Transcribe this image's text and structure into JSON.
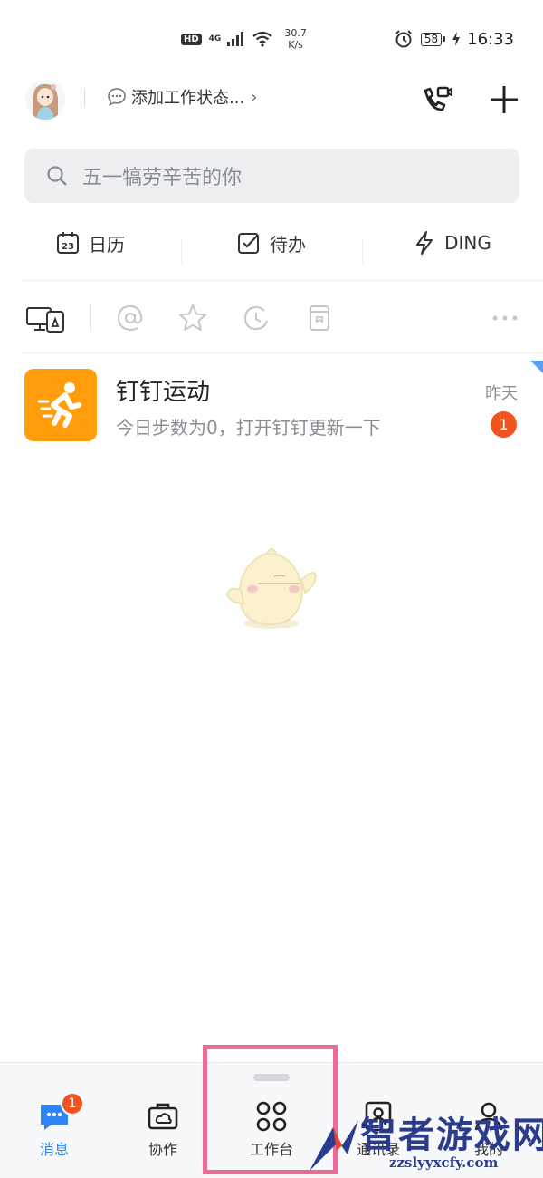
{
  "status_bar": {
    "hd": "HD",
    "network": "4G",
    "speed_value": "30.7",
    "speed_unit": "K/s",
    "battery": "58",
    "time": "16:33"
  },
  "header": {
    "work_status": "添加工作状态...",
    "chevron": "›"
  },
  "search": {
    "placeholder": "五一犒劳辛苦的你"
  },
  "quick_tabs": [
    {
      "label": "日历",
      "icon": "calendar-icon",
      "day": "23"
    },
    {
      "label": "待办",
      "icon": "todo-check-icon"
    },
    {
      "label": "DING",
      "icon": "lightning-icon"
    }
  ],
  "filters": [
    "devices-icon",
    "mention-icon",
    "star-icon",
    "recent-icon",
    "bookmark-icon",
    "more-icon"
  ],
  "conversations": [
    {
      "title": "钉钉运动",
      "preview": "今日步数为0，打开钉钉更新一下",
      "time": "昨天",
      "unread": "1",
      "avatar_color": "#ff9d0a"
    }
  ],
  "bottom_nav": [
    {
      "label": "消息",
      "icon": "message-icon",
      "badge": "1",
      "active": true
    },
    {
      "label": "协作",
      "icon": "briefcase-cloud-icon"
    },
    {
      "label": "工作台",
      "icon": "grid-apps-icon"
    },
    {
      "label": "通讯录",
      "icon": "contacts-icon"
    },
    {
      "label": "我的",
      "icon": "profile-icon"
    }
  ],
  "watermark": {
    "title": "智者游戏网",
    "url": "zzslyyxcfy.com"
  },
  "colors": {
    "accent_blue": "#2f84f4",
    "badge_red": "#f0541e",
    "sport_orange": "#ff9d0a",
    "highlight_pink": "#ea6b96"
  }
}
